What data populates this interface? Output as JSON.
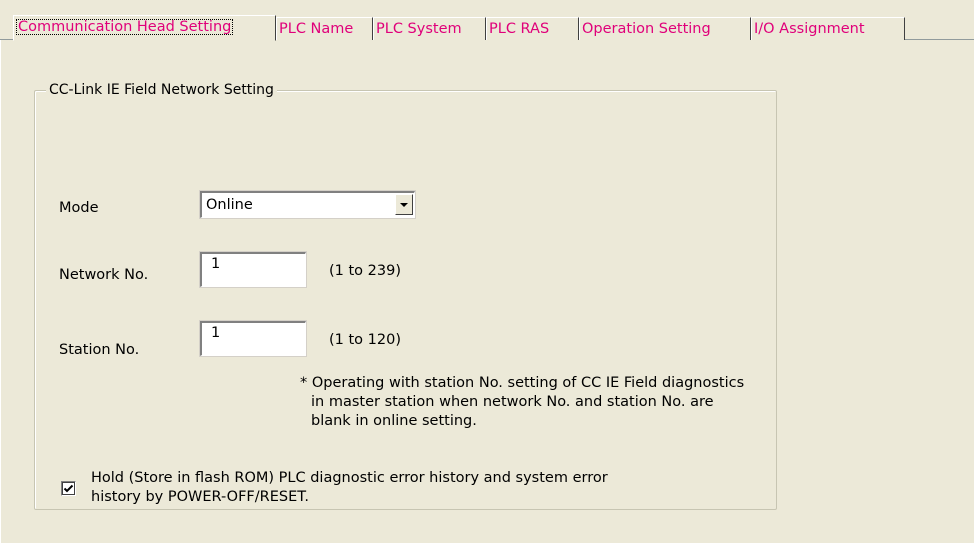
{
  "tabs": [
    {
      "label": "Communication Head Setting",
      "active": true
    },
    {
      "label": "PLC Name",
      "active": false
    },
    {
      "label": "PLC System",
      "active": false
    },
    {
      "label": "PLC RAS",
      "active": false
    },
    {
      "label": "Operation Setting",
      "active": false
    },
    {
      "label": "I/O Assignment",
      "active": false
    }
  ],
  "group": {
    "title": "CC-Link IE Field Network Setting"
  },
  "mode": {
    "label": "Mode",
    "value": "Online",
    "dropdown_icon": "chevron-down-icon"
  },
  "network_no": {
    "label": "Network No.",
    "value": "1",
    "range": "(1 to 239)"
  },
  "station_no": {
    "label": "Station No.",
    "value": "1",
    "range": "(1 to 120)"
  },
  "note": {
    "line1": "* Operating with station No. setting of CC IE Field diagnostics",
    "line2": "in master station when network No. and station No. are",
    "line3": "blank in online setting."
  },
  "hold_checkbox": {
    "checked": true,
    "line1": "Hold (Store in flash ROM) PLC diagnostic error history and system error",
    "line2": "history by POWER-OFF/RESET."
  },
  "colors": {
    "tab_text": "#e0007a",
    "background": "#ece9d8"
  }
}
